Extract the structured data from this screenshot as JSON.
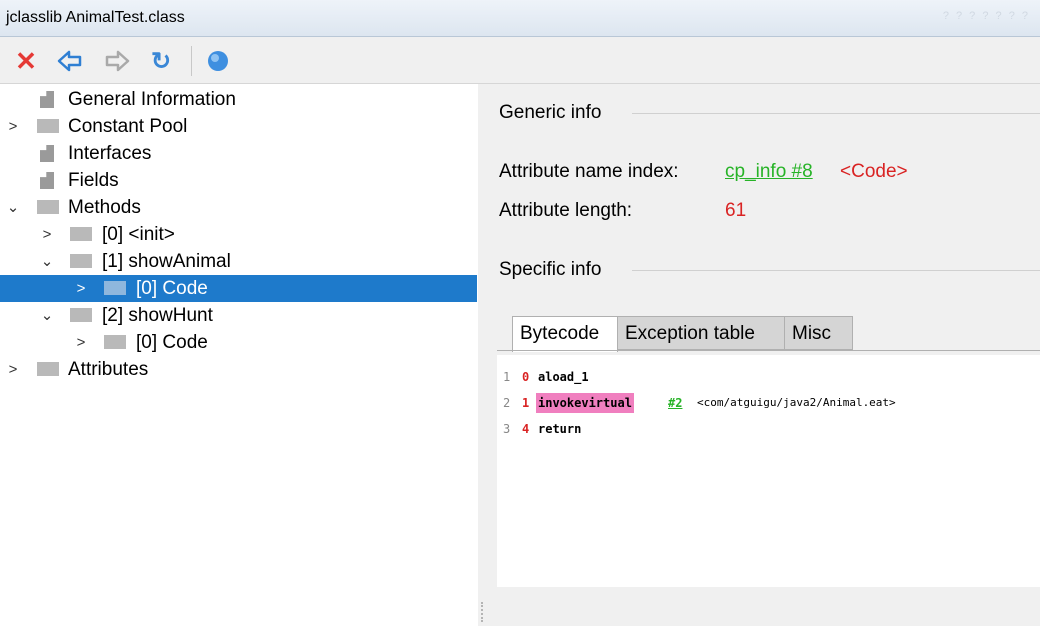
{
  "window": {
    "title": "jclasslib AnimalTest.class",
    "controls": "? ? ? ? ? ? ?"
  },
  "toolbar": {
    "close_icon": "✕",
    "back_icon": "⇦",
    "forward_icon": "⇨",
    "refresh_icon": "↻",
    "web_icon": "globe"
  },
  "tree": {
    "general": "General Information",
    "constant_pool": "Constant Pool",
    "interfaces": "Interfaces",
    "fields": "Fields",
    "methods": "Methods",
    "m0": "[0] <init>",
    "m1": "[1] showAnimal",
    "m1_code": "[0] Code",
    "m2": "[2] showHunt",
    "m2_code": "[0] Code",
    "attributes": "Attributes",
    "chev_collapsed": ">",
    "chev_expanded": "⌄"
  },
  "generic": {
    "title": "Generic info",
    "name_index_label": "Attribute name index:",
    "name_index_link": "cp_info #8",
    "name_index_value": "<Code>",
    "length_label": "Attribute length:",
    "length_value": "61"
  },
  "specific": {
    "title": "Specific info",
    "tabs": [
      "Bytecode",
      "Exception table",
      "Misc"
    ]
  },
  "bytecode": [
    {
      "line": "1",
      "offset": "0",
      "opcode": "aload_1",
      "ref": "",
      "comment": ""
    },
    {
      "line": "2",
      "offset": "1",
      "opcode": "invokevirtual",
      "ref": "#2",
      "comment": "<com/atguigu/java2/Animal.eat>"
    },
    {
      "line": "3",
      "offset": "4",
      "opcode": "return",
      "ref": "",
      "comment": ""
    }
  ],
  "colors": {
    "selection": "#1e7acb",
    "link": "#27b327",
    "value": "#d92323",
    "highlight": "#f07fbf"
  }
}
